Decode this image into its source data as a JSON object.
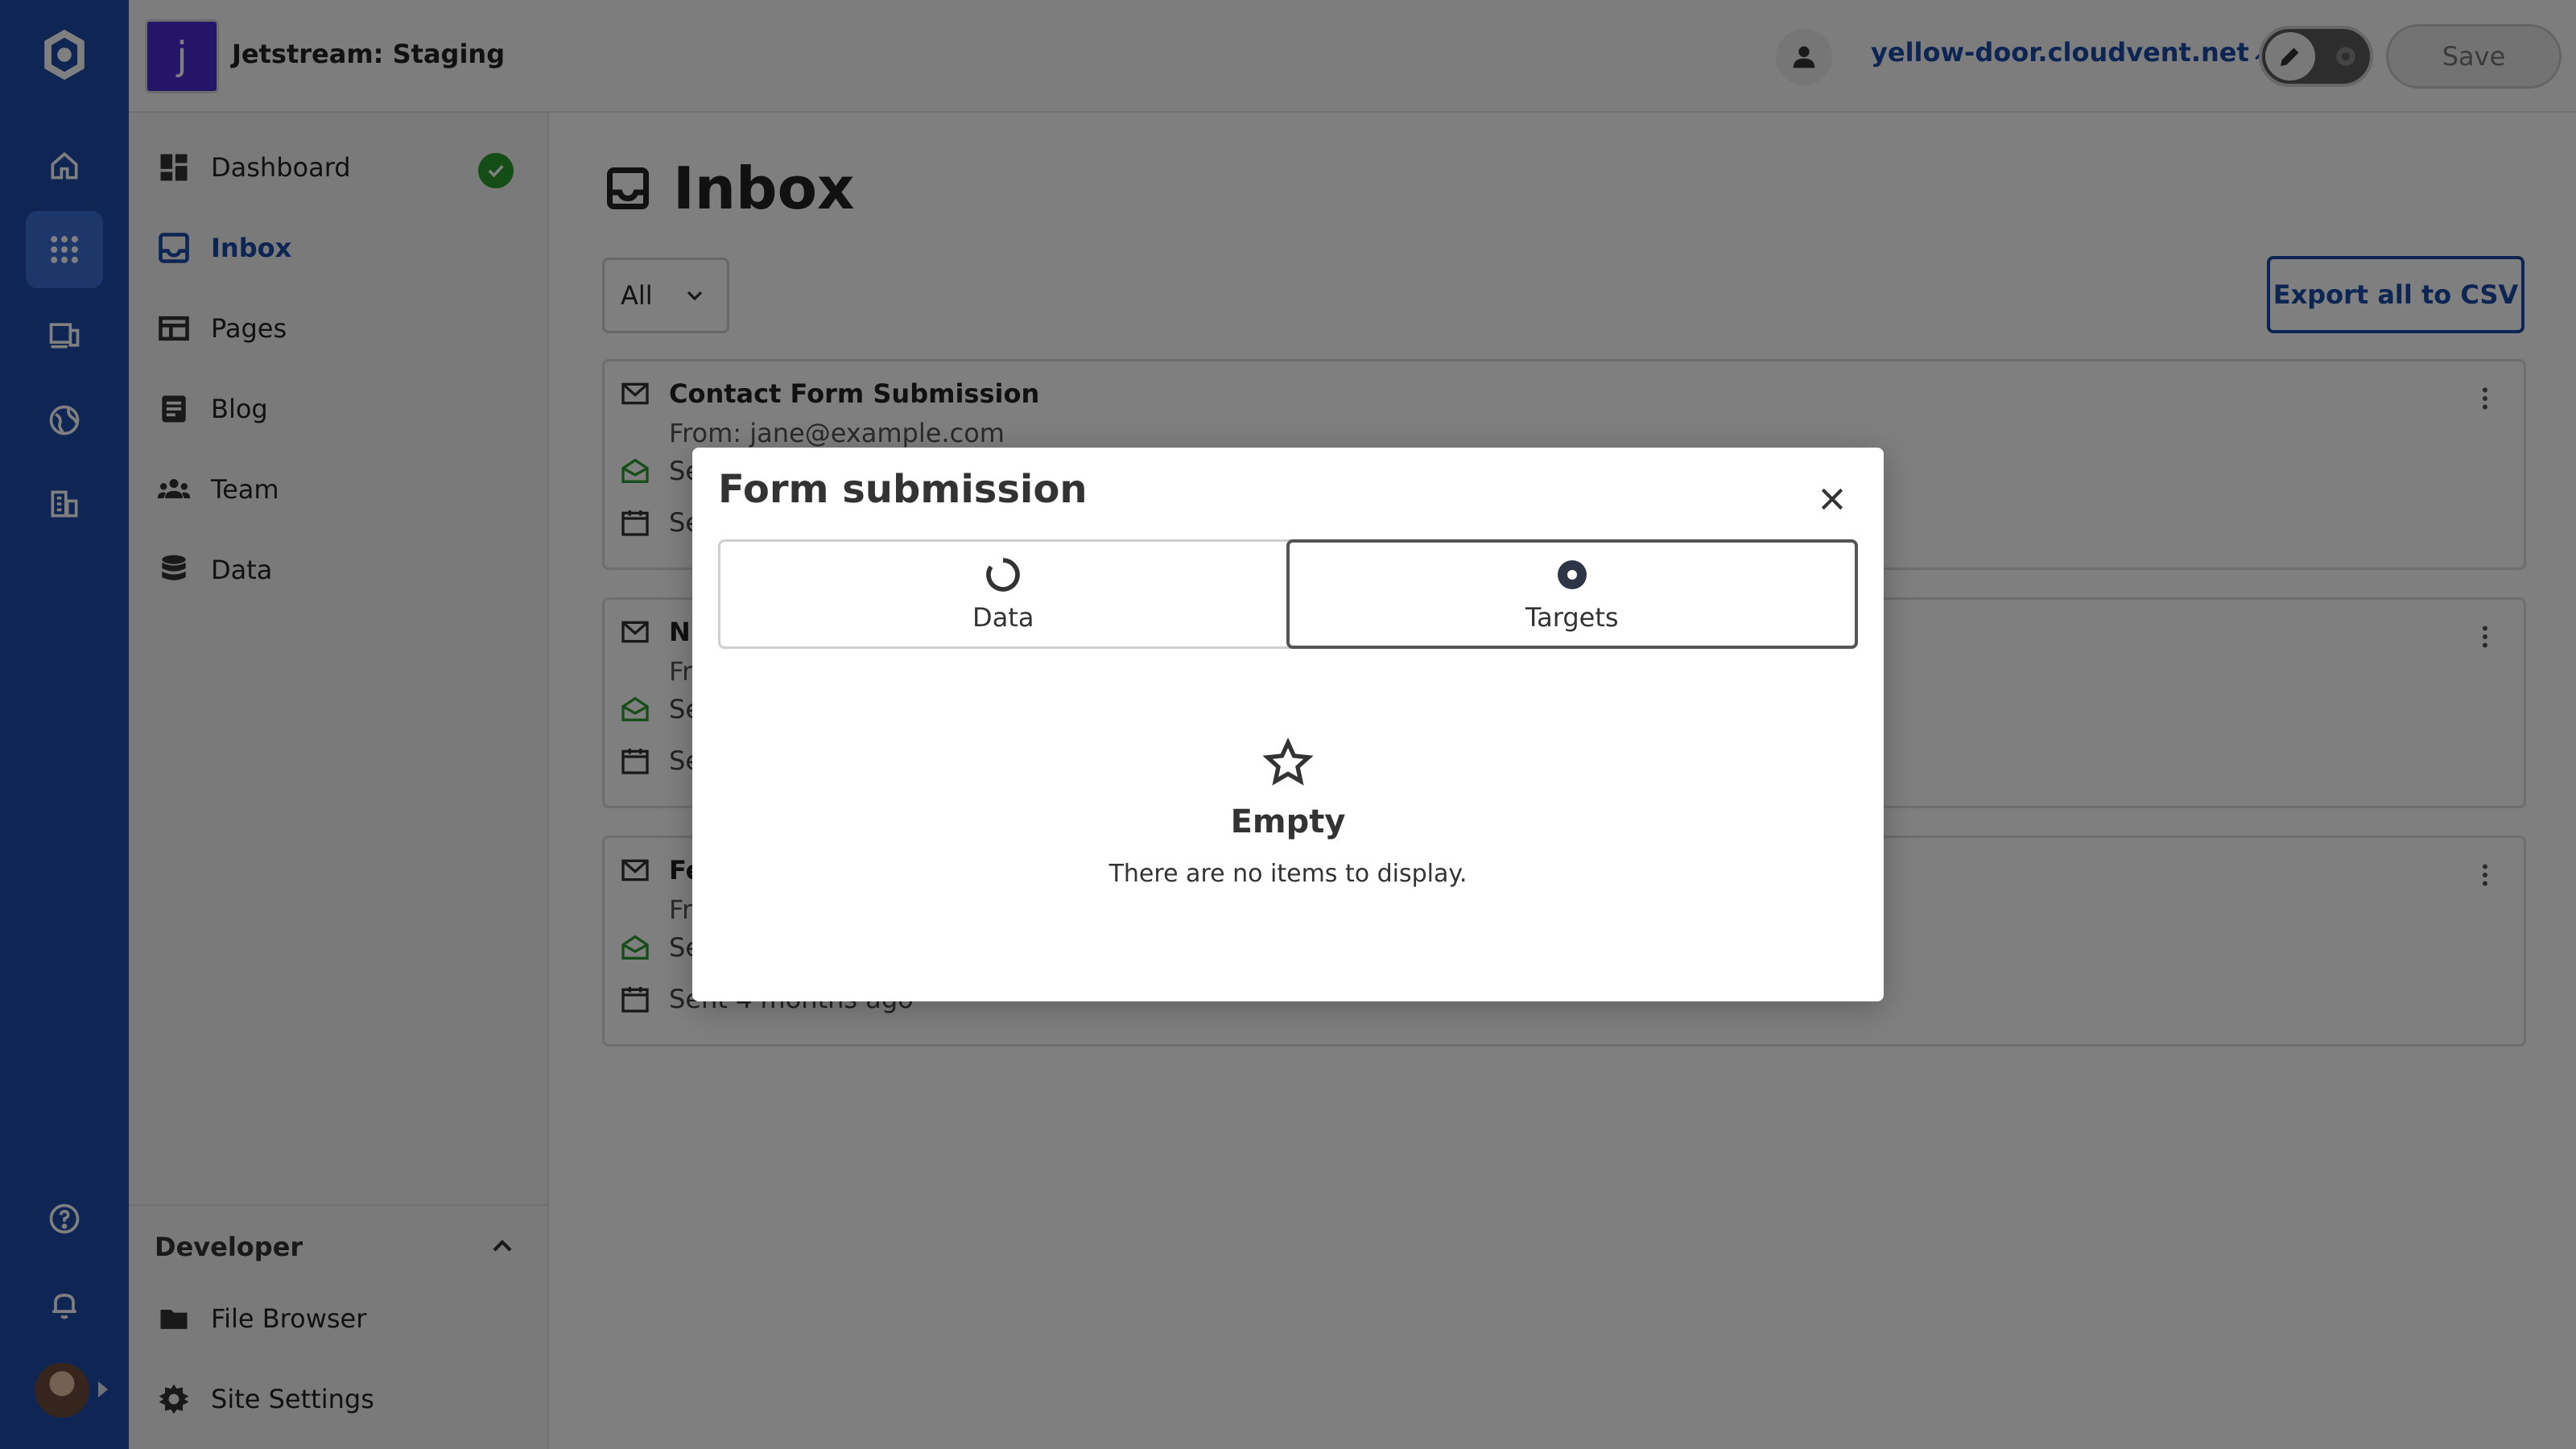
{
  "header": {
    "site_initial": "j",
    "site_name": "Jetstream: Staging",
    "site_url": "yellow-door.cloudvent.net",
    "save_label": "Save"
  },
  "rail": {
    "icons": [
      "logo-icon",
      "home-icon",
      "apps-icon",
      "devices-icon",
      "globe-icon",
      "organization-icon",
      "help-icon",
      "bell-icon"
    ]
  },
  "sidebar": {
    "items": [
      {
        "label": "Dashboard",
        "icon": "dashboard-icon"
      },
      {
        "label": "Inbox",
        "icon": "inbox-icon",
        "active": true
      },
      {
        "label": "Pages",
        "icon": "pages-icon"
      },
      {
        "label": "Blog",
        "icon": "blog-icon"
      },
      {
        "label": "Team",
        "icon": "team-icon"
      },
      {
        "label": "Data",
        "icon": "database-icon"
      }
    ],
    "developer": {
      "title": "Developer",
      "items": [
        {
          "label": "File Browser",
          "icon": "folder-icon"
        },
        {
          "label": "Site Settings",
          "icon": "gear-icon"
        }
      ]
    }
  },
  "main": {
    "title": "Inbox",
    "filter_value": "All",
    "export_label": "Export all to CSV",
    "cards": [
      {
        "title": "Contact Form Submission",
        "from": "From: jane@example.com",
        "status_prefix": "Se",
        "date_prefix": "Se"
      },
      {
        "title": "N",
        "from": "Fr",
        "status_prefix": "Se",
        "date_prefix": "Se"
      },
      {
        "title": "Fe",
        "from": "Fr",
        "status_prefix": "Se",
        "date": "Sent 4 months ago"
      }
    ]
  },
  "modal": {
    "title": "Form submission",
    "tabs": [
      {
        "label": "Data",
        "icon": "loading-icon"
      },
      {
        "label": "Targets",
        "icon": "radio-selected-icon",
        "active": true
      }
    ],
    "empty_title": "Empty",
    "empty_desc": "There are no items to display."
  },
  "colors": {
    "rail": "#1e4ba6",
    "accent": "#1a4aa6",
    "success": "#2b9a2e",
    "site_badge": "#4a2bd1"
  }
}
